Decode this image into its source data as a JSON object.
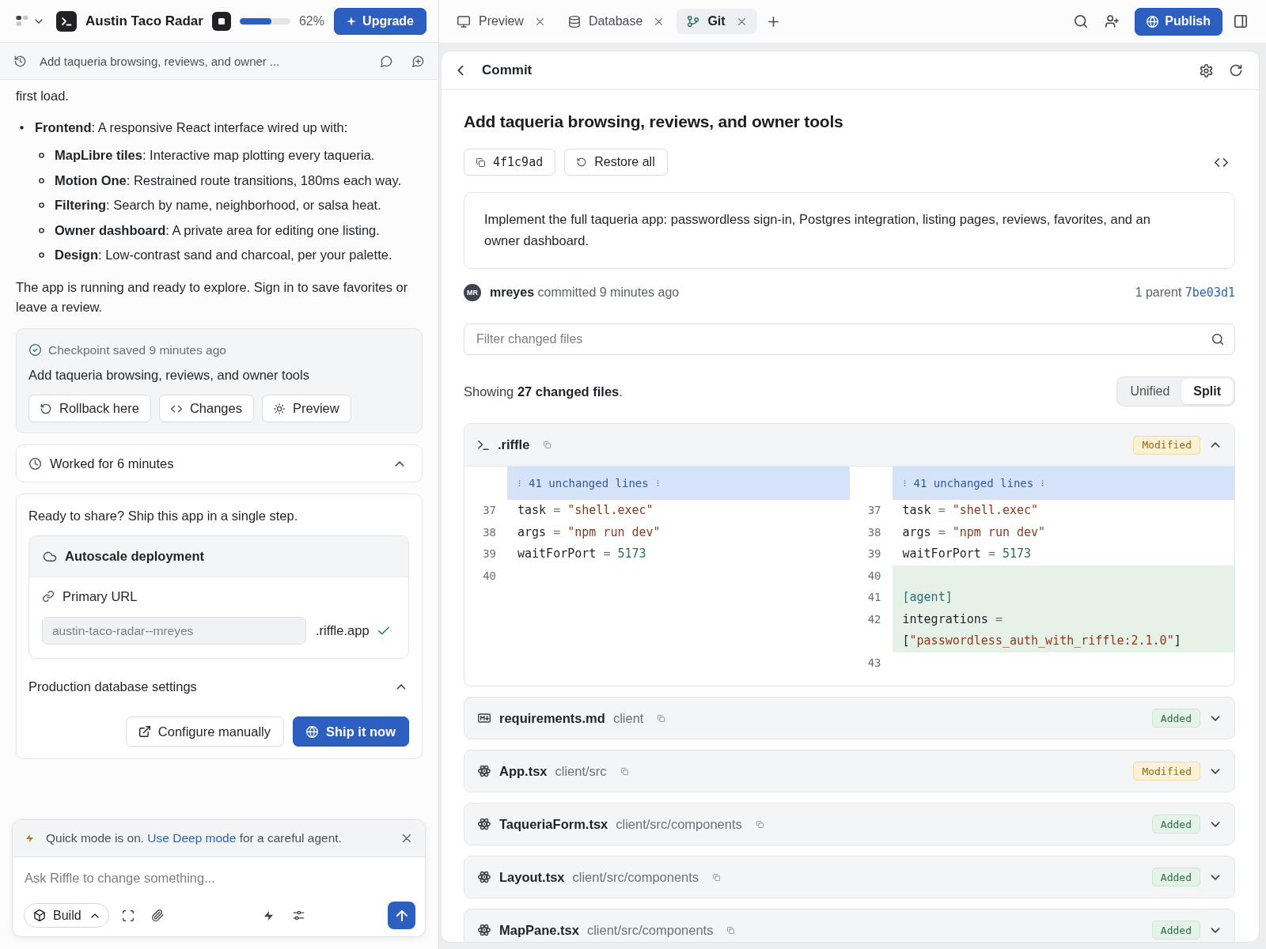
{
  "app_bar": {
    "title": "Austin Taco Radar",
    "build_progress": {
      "level": 0.62,
      "reading": "62%"
    },
    "upgrade_button": "Upgrade"
  },
  "chat_header": {
    "title": "Add taqueria browsing, reviews, and owner ..."
  },
  "chat": {
    "intro_tail": "first load.",
    "bullets": [
      {
        "text": "**Frontend**: A responsive React interface wired up with:",
        "children": [
          {
            "text": "**MapLibre tiles**: Interactive map plotting every taqueria."
          },
          {
            "text": "**Motion One**: Restrained route transitions, 180ms each way."
          },
          {
            "text": "**Filtering**: Search by name, neighborhood, or salsa heat."
          },
          {
            "text": "**Owner dashboard**: A private area for editing one listing."
          },
          {
            "text": "**Design**: Low-contrast sand and charcoal, per your palette."
          }
        ]
      }
    ],
    "closing": "The app is running and ready to explore. Sign in to save favorites or leave a review."
  },
  "checkpoint": {
    "status": "Checkpoint saved 9 minutes ago",
    "title": "Add taqueria browsing, reviews, and owner tools",
    "actions": [
      {
        "label": "Rollback here",
        "kind": "rollback"
      },
      {
        "label": "Changes",
        "kind": "changes"
      },
      {
        "label": "Preview",
        "kind": "preview"
      }
    ]
  },
  "work_summary": {
    "label": "Worked for 6 minutes"
  },
  "deploy": {
    "prompt": "Ready to share? Ship this app in a single step.",
    "deployment": {
      "title": "Autoscale deployment",
      "url_label": "Primary URL",
      "subdomain": "austin-taco-radar--mreyes",
      "domain": ".riffle.app"
    },
    "database_settings": "Production database settings",
    "buttons": [
      {
        "label": "Configure manually",
        "kind": "secondary"
      },
      {
        "label": "Ship it now",
        "kind": "primary"
      }
    ]
  },
  "mode_notice": {
    "before": "Quick mode is on.",
    "link": "Use Deep mode",
    "after": "for a careful agent."
  },
  "composer": {
    "placeholder": "Ask Riffle to change something...",
    "mode_button": "Build"
  },
  "tabs": [
    {
      "label": "Preview",
      "kind": "preview",
      "selected": false
    },
    {
      "label": "Database",
      "kind": "database",
      "selected": false
    },
    {
      "label": "Git",
      "kind": "git",
      "selected": true
    }
  ],
  "publish_button": "Publish",
  "commit": {
    "header": "Commit",
    "title": "Add taqueria browsing, reviews, and owner tools",
    "hash": "4f1c9ad",
    "restore_button": "Restore all",
    "message": "Implement the full taqueria app: passwordless sign-in, Postgres integration, listing pages, reviews, favorites, and an owner dashboard.",
    "avatar": "MR",
    "author_line": "**mreyes** committed 9 minutes ago",
    "parent_label": "1 parent",
    "parent_hash": "7be03d1",
    "filter": {
      "placeholder": "Filter changed files"
    },
    "summary": "Showing **27 changed files**.",
    "view_modes": [
      {
        "label": "Unified",
        "selected": false
      },
      {
        "label": "Split",
        "selected": true
      }
    ],
    "files": [
      {
        "name": ".riffle",
        "kind": "config",
        "status": {
          "label": "Modified",
          "kind": "modified"
        },
        "expanded": true,
        "diff": {
          "left": {
            "hunk": "41 unchanged lines",
            "lines": [
              {
                "number": "37",
                "added": false,
                "tokens": [
                  {
                    "text": "task ",
                    "kind": "plain"
                  },
                  {
                    "text": "= ",
                    "kind": "operator"
                  },
                  {
                    "text": "\"shell.exec\"",
                    "kind": "string"
                  }
                ]
              },
              {
                "number": "38",
                "added": false,
                "tokens": [
                  {
                    "text": "args ",
                    "kind": "plain"
                  },
                  {
                    "text": "= ",
                    "kind": "operator"
                  },
                  {
                    "text": "\"npm run dev\"",
                    "kind": "string"
                  }
                ]
              },
              {
                "number": "39",
                "added": false,
                "tokens": [
                  {
                    "text": "waitForPort ",
                    "kind": "plain"
                  },
                  {
                    "text": "= ",
                    "kind": "operator"
                  },
                  {
                    "text": "5173",
                    "kind": "number"
                  }
                ]
              },
              {
                "number": "40",
                "added": false
              }
            ]
          },
          "right": {
            "hunk": "41 unchanged lines",
            "lines": [
              {
                "number": "37",
                "added": false,
                "tokens": [
                  {
                    "text": "task ",
                    "kind": "plain"
                  },
                  {
                    "text": "= ",
                    "kind": "operator"
                  },
                  {
                    "text": "\"shell.exec\"",
                    "kind": "string"
                  }
                ]
              },
              {
                "number": "38",
                "added": false,
                "tokens": [
                  {
                    "text": "args ",
                    "kind": "plain"
                  },
                  {
                    "text": "= ",
                    "kind": "operator"
                  },
                  {
                    "text": "\"npm run dev\"",
                    "kind": "string"
                  }
                ]
              },
              {
                "number": "39",
                "added": false,
                "tokens": [
                  {
                    "text": "waitForPort ",
                    "kind": "plain"
                  },
                  {
                    "text": "= ",
                    "kind": "operator"
                  },
                  {
                    "text": "5173",
                    "kind": "number"
                  }
                ]
              },
              {
                "number": "40",
                "added": true
              },
              {
                "number": "41",
                "added": true,
                "tokens": [
                  {
                    "text": "[agent]",
                    "kind": "section"
                  }
                ]
              },
              {
                "number": "42",
                "added": true,
                "tokens": [
                  {
                    "text": "integrations ",
                    "kind": "plain"
                  },
                  {
                    "text": "= ",
                    "kind": "operator"
                  },
                  {
                    "text": "[",
                    "kind": "plain"
                  },
                  {
                    "text": "\"passwordless_auth_with_riffle:2.1.0\"",
                    "kind": "string"
                  },
                  {
                    "text": "]",
                    "kind": "plain"
                  }
                ]
              },
              {
                "number": "43",
                "added": false
              }
            ]
          }
        }
      },
      {
        "name": "requirements.md",
        "path": "client",
        "kind": "markdown",
        "status": {
          "label": "Added",
          "kind": "added"
        },
        "expanded": false
      },
      {
        "name": "App.tsx",
        "path": "client/src",
        "kind": "react",
        "status": {
          "label": "Modified",
          "kind": "modified"
        },
        "expanded": false
      },
      {
        "name": "TaqueriaForm.tsx",
        "path": "client/src/components",
        "kind": "react",
        "status": {
          "label": "Added",
          "kind": "added"
        },
        "expanded": false
      },
      {
        "name": "Layout.tsx",
        "path": "client/src/components",
        "kind": "react",
        "status": {
          "label": "Added",
          "kind": "added"
        },
        "expanded": false
      },
      {
        "name": "MapPane.tsx",
        "path": "client/src/components",
        "kind": "react",
        "status": {
          "label": "Added",
          "kind": "added"
        },
        "expanded": false
      }
    ]
  }
}
